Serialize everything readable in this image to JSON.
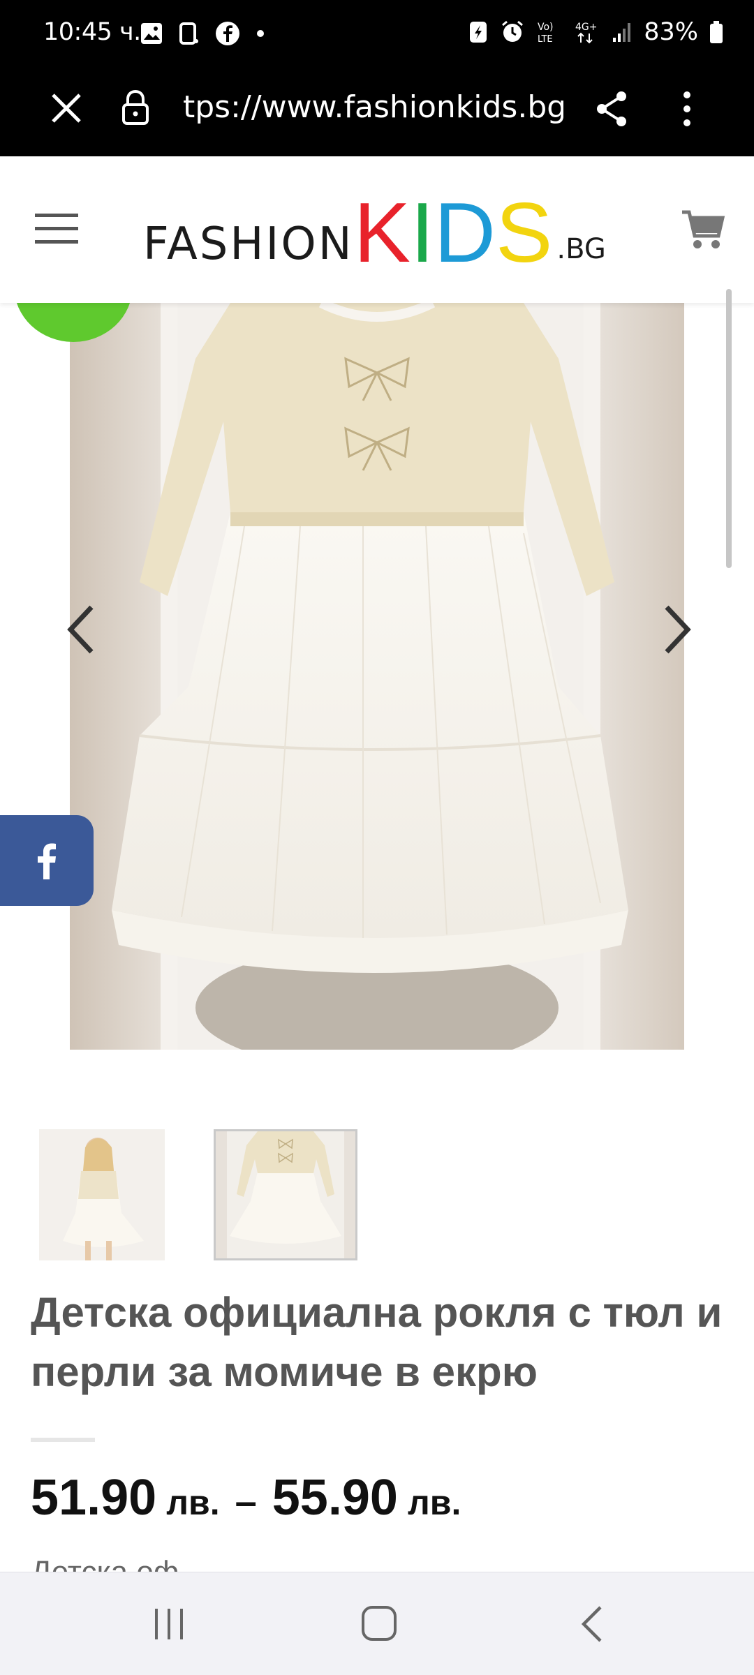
{
  "status_bar": {
    "time": "10:45 ч.",
    "battery": "83%"
  },
  "browser": {
    "url": "tps://www.fashionkids.bg/p"
  },
  "site": {
    "logo_fashion": "FASHION",
    "logo_k": "K",
    "logo_i": "I",
    "logo_d": "D",
    "logo_s": "S",
    "logo_suffix": ".BG"
  },
  "product": {
    "title": "Детска официална рокля с тюл и перли за момиче в екрю",
    "price_min": "51.90",
    "price_max": "55.90",
    "currency": "лв.",
    "price_separator": "–",
    "cutoff_text": "Детска оф"
  },
  "colors": {
    "accent_green": "#5fc92e",
    "facebook_blue": "#3b5998",
    "logo_red": "#e8222b",
    "logo_green": "#1aa84a",
    "logo_blue": "#1d9ad6",
    "logo_yellow": "#f2d40f"
  },
  "icons": [
    "close-icon",
    "lock-icon",
    "share-icon",
    "more-vert-icon",
    "hamburger-menu-icon",
    "cart-icon",
    "chevron-left-icon",
    "chevron-right-icon",
    "facebook-icon",
    "recents-icon",
    "home-icon",
    "back-icon"
  ]
}
